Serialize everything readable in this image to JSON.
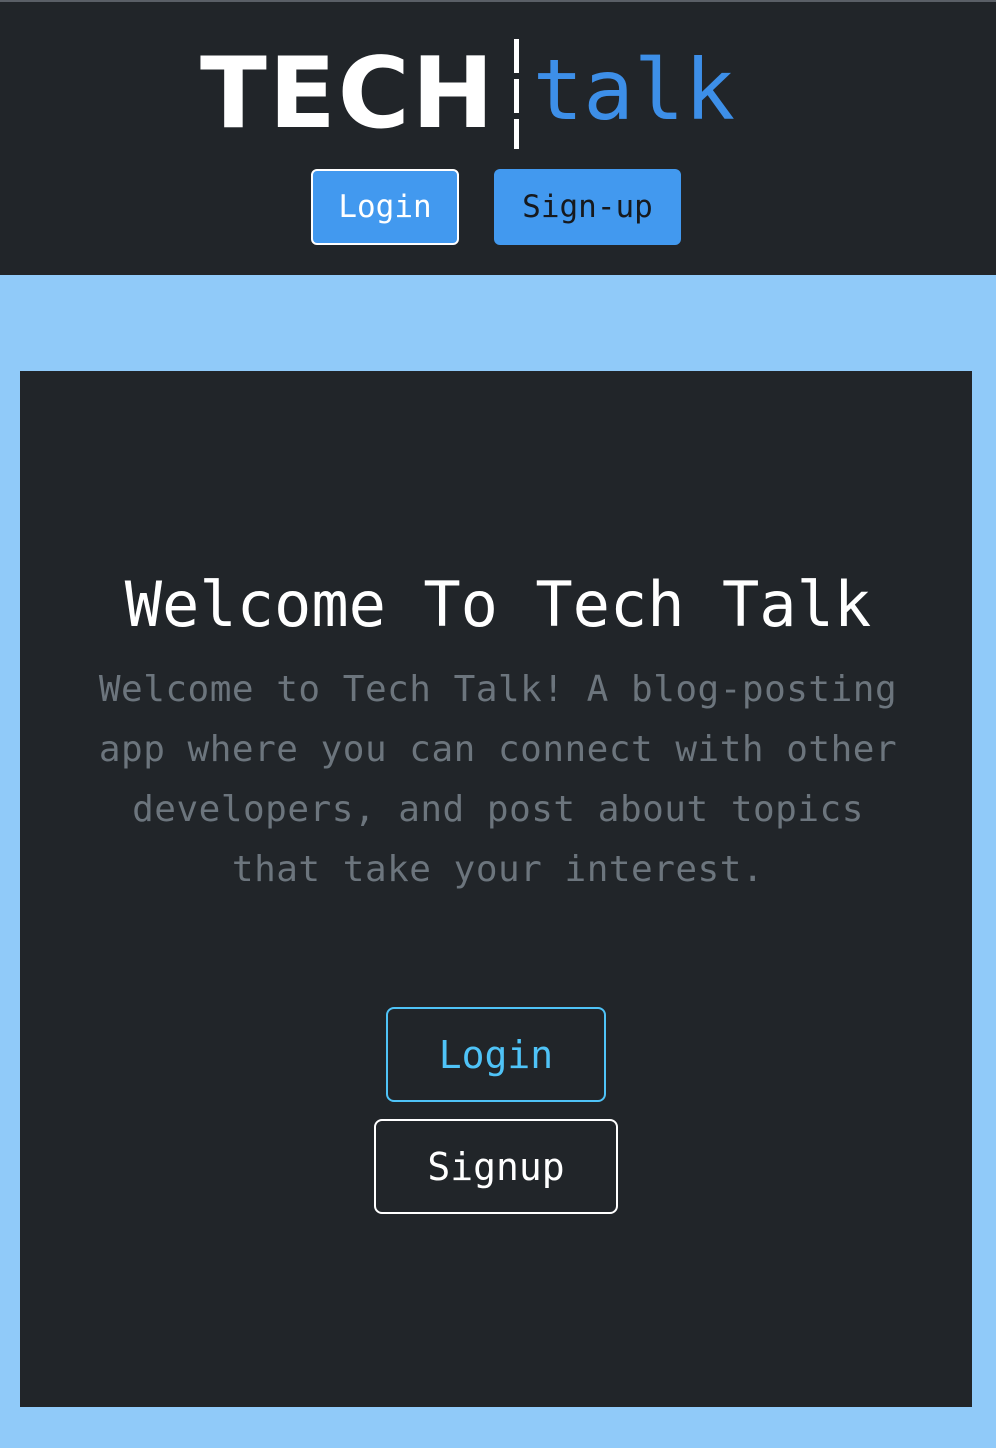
{
  "header": {
    "logo": {
      "part1": "TECH",
      "part2": "talk"
    },
    "login_label": "Login",
    "signup_label": "Sign-up"
  },
  "hero": {
    "title": "Welcome To Tech Talk",
    "description": "Welcome to Tech Talk! A blog-posting app where you can connect with other developers, and post about topics that take your interest.",
    "login_label": "Login",
    "signup_label": "Signup"
  },
  "colors": {
    "navbar_bg": "#212529",
    "page_bg": "#90caf9",
    "accent_blue": "#4299ef",
    "logo_blue": "#3d8fe8",
    "login_outline": "#4fc3f7",
    "muted_text": "#6c757d"
  }
}
